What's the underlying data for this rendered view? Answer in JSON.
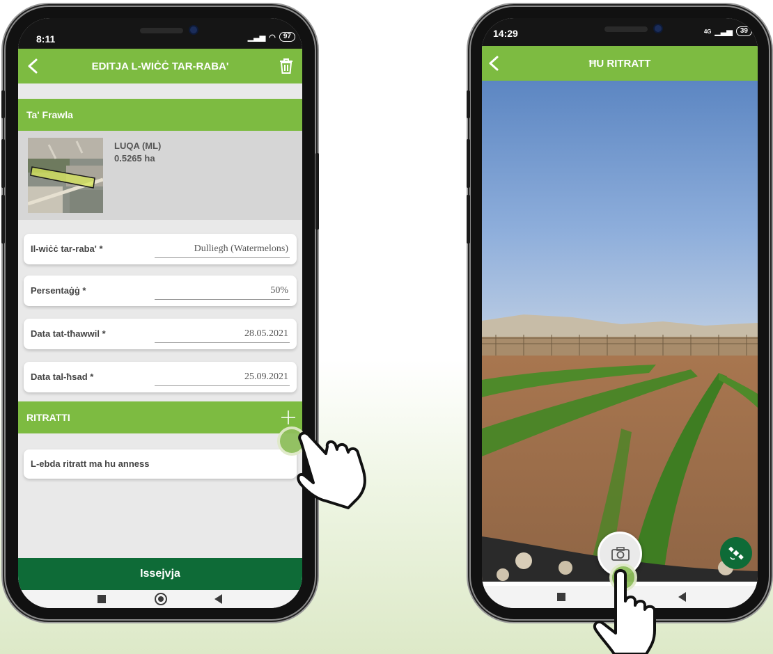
{
  "left_phone": {
    "status": {
      "time": "8:11",
      "battery": "97"
    },
    "appbar": {
      "title": "EDITJA L-WIĊĊ TAR-RABA'"
    },
    "parcel": {
      "name": "Ta' Frawla",
      "locality": "LUQA (ML)",
      "area": "0.5265 ha"
    },
    "fields": [
      {
        "label": "Il-wiċċ tar-raba' *",
        "value": "Dulliegħ (Watermelons)"
      },
      {
        "label": "Persentaġġ *",
        "value": "50%"
      },
      {
        "label": "Data tat-tħawwil *",
        "value": "28.05.2021"
      },
      {
        "label": "Data tal-ħsad *",
        "value": "25.09.2021"
      }
    ],
    "photos": {
      "header": "RITRATTI",
      "empty_text": "L-ebda ritratt ma hu anness"
    },
    "save_button": "Issejvja"
  },
  "right_phone": {
    "status": {
      "time": "14:29",
      "battery": "39",
      "network": "4G"
    },
    "appbar": {
      "title": "ĦU RITRATT"
    }
  },
  "colors": {
    "brand_green": "#7dbb41",
    "dark_green": "#0e6b37"
  },
  "icons": [
    "chevron-left-icon",
    "trash-icon",
    "plus-icon",
    "camera-icon",
    "satellite-icon",
    "hand-pointer-icon"
  ]
}
